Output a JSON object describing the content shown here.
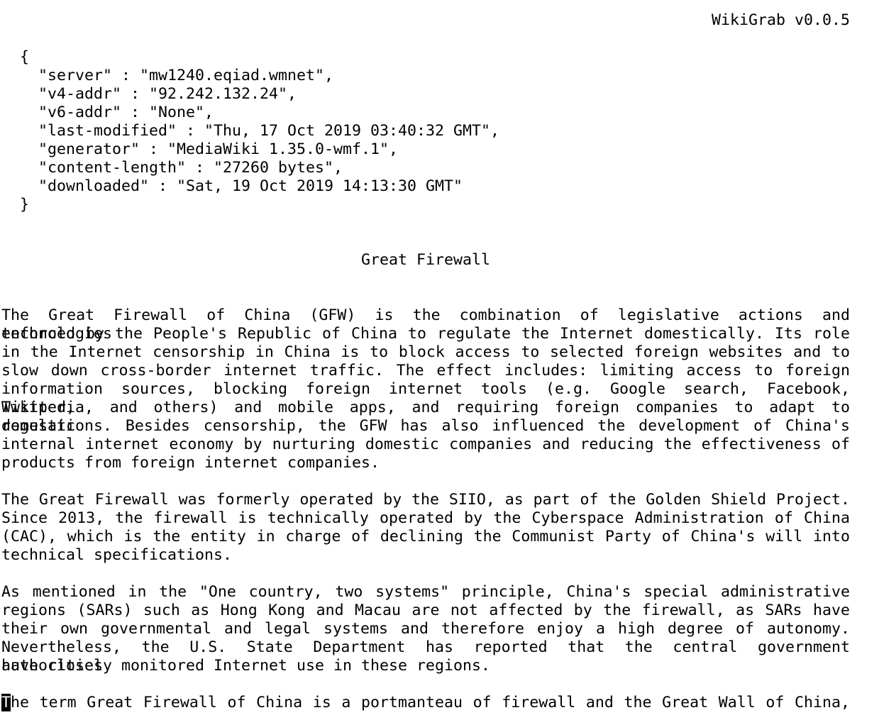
{
  "app": {
    "title": "WikiGrab v0.0.5"
  },
  "metadata_block": {
    "open_brace": "  {",
    "lines": [
      "    \"server\" : \"mw1240.eqiad.wmnet\",",
      "    \"v4-addr\" : \"92.242.132.24\",",
      "    \"v6-addr\" : \"None\",",
      "    \"last-modified\" : \"Thu, 17 Oct 2019 03:40:32 GMT\",",
      "    \"generator\" : \"MediaWiki 1.35.0-wmf.1\",",
      "    \"content-length\" : \"27260 bytes\",",
      "    \"downloaded\" : \"Sat, 19 Oct 2019 14:13:30 GMT\""
    ],
    "close_brace": "  }"
  },
  "article": {
    "title": "Great Firewall",
    "paragraph_1": [
      "The Great Firewall of China (GFW) is the combination of legislative actions and technologies",
      "enforced  by the People's Republic of China to regulate the Internet domestically. Its  role",
      "in  the Internet censorship in China is to block access to selected foreign websites and  to",
      "slow  down  cross-border internet traffic. The effect includes: limiting access  to  foreign",
      "information sources, blocking foreign internet tools (e.g. Google search, Facebook, Twitter,",
      "Wikipedia, and others) and mobile apps, and requiring foreign companies to adapt to domestic",
      "regulations.  Besides  censorship,  the GFW has also influenced the development  of  China's",
      "internal  internet economy by nurturing domestic companies and reducing the effectiveness of",
      "products from foreign internet companies."
    ],
    "paragraph_2": [
      "The  Great Firewall was formerly operated by the SIIO, as part of the Golden Shield Project.",
      "Since  2013, the firewall is technically operated by the Cyberspace Administration of  China",
      "(CAC),  which is the entity in charge of declining the Communist Party of China's will  into",
      "technical specifications."
    ],
    "paragraph_3": [
      "As  mentioned  in the \"One country, two systems\" principle, China's  special  administrative",
      "regions  (SARs)  such as Hong Kong and Macau are not affected by the firewall, as SARs  have",
      "their  own  governmental  and legal systems and therefore enjoy a high degree  of  autonomy.",
      "Nevertheless, the U.S. State Department has reported that the central government authorities",
      "have closely monitored Internet use in these regions."
    ],
    "paragraph_4_cursor_char": "T",
    "paragraph_4_first_line_rest": "he  term Great Firewall of China is a portmanteau of firewall and the Great Wall of  China,"
  }
}
